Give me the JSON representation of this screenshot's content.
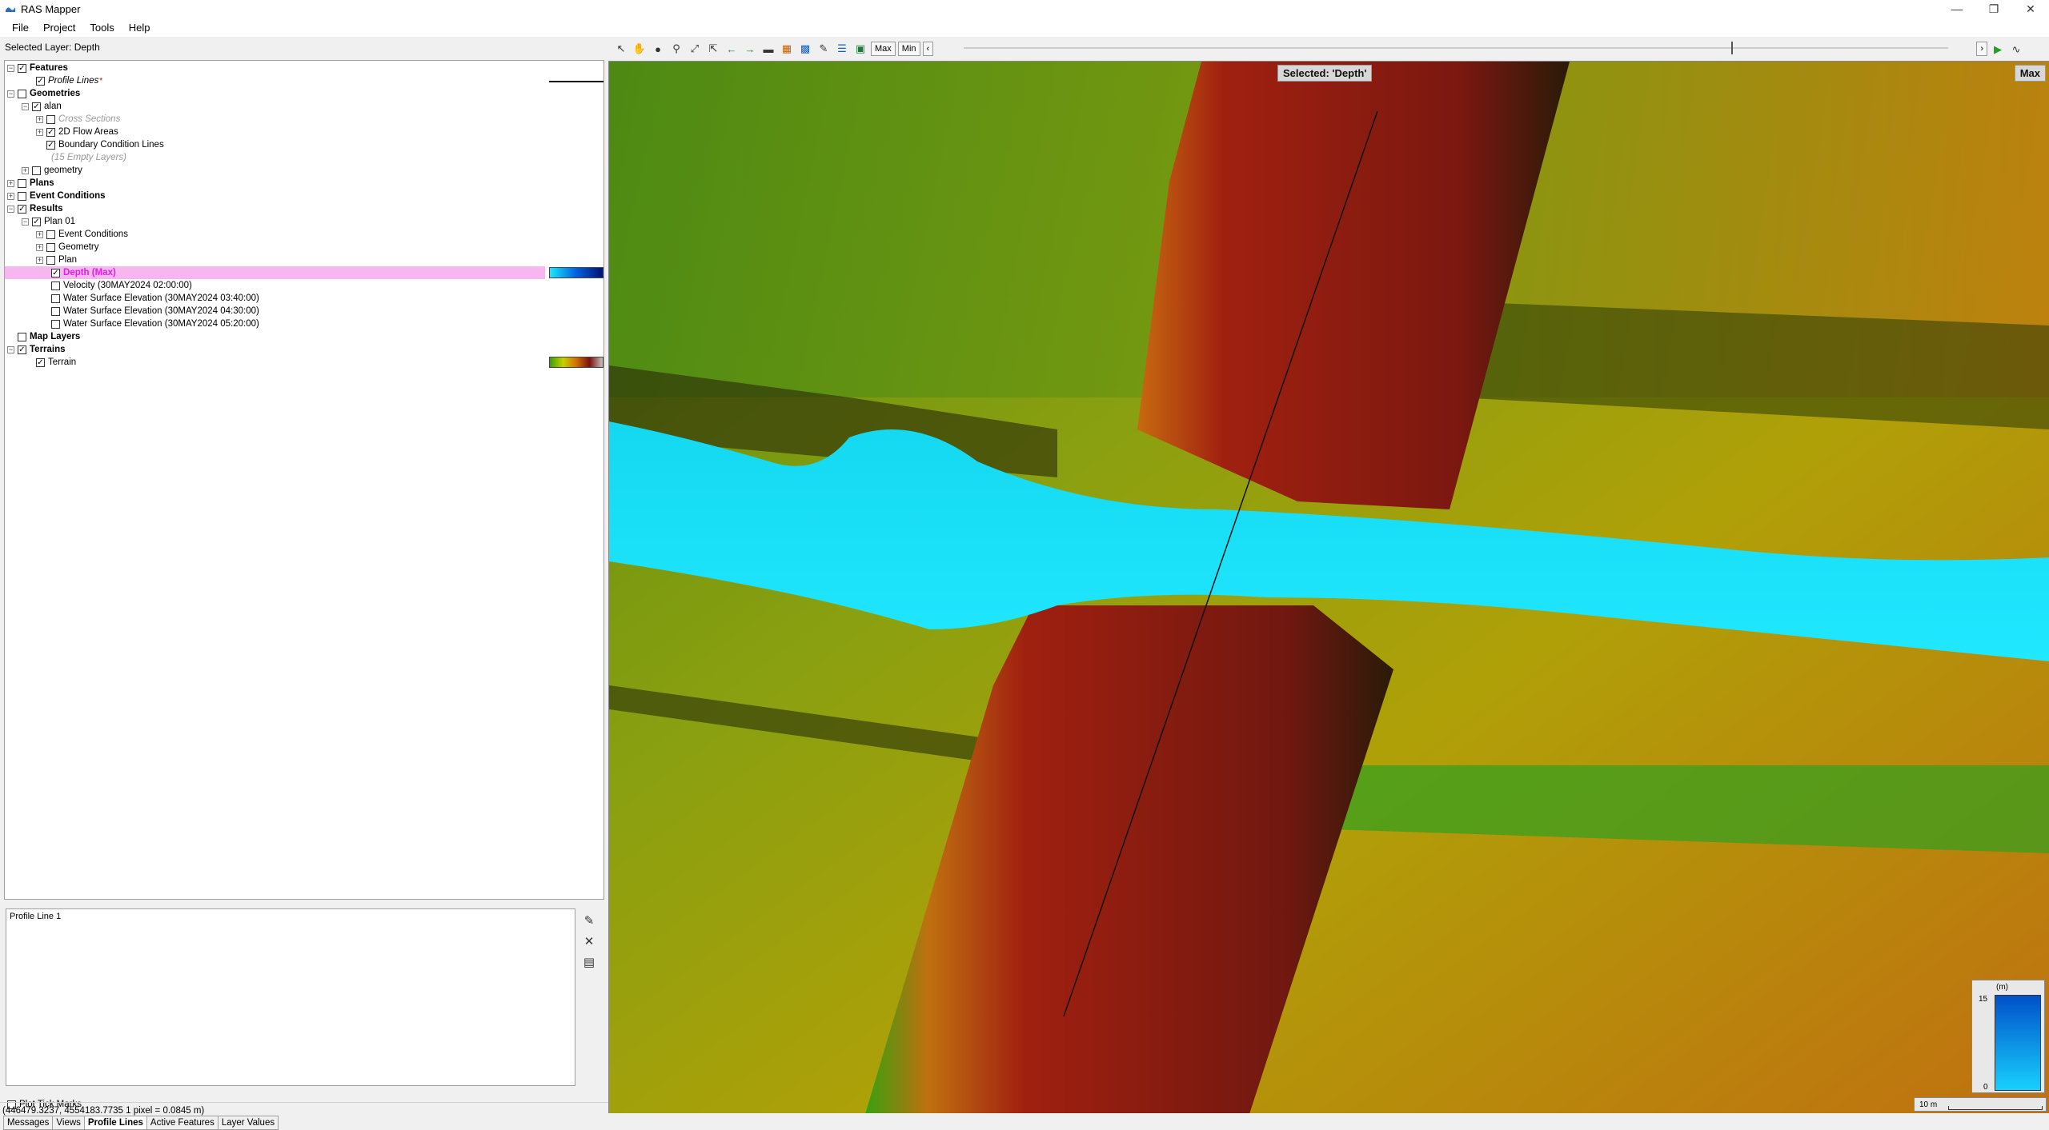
{
  "window": {
    "title": "RAS Mapper"
  },
  "menu": [
    "File",
    "Project",
    "Tools",
    "Help"
  ],
  "selected_layer": "Selected Layer: Depth",
  "tree": {
    "features": "Features",
    "profile_lines": "Profile Lines",
    "profile_lines_mark": "*",
    "geometries": "Geometries",
    "alan": "alan",
    "cross_sections": "Cross Sections",
    "flow_areas": "2D Flow Areas",
    "bc_lines": "Boundary Condition Lines",
    "empty_layers": "(15 Empty Layers)",
    "geometry": "geometry",
    "plans": "Plans",
    "event_conditions": "Event Conditions",
    "results": "Results",
    "plan01": "Plan 01",
    "r_event_conditions": "Event Conditions",
    "r_geometry": "Geometry",
    "r_plan": "Plan",
    "depth": "Depth (Max)",
    "velocity": "Velocity (30MAY2024 02:00:00)",
    "wse1": "Water Surface Elevation (30MAY2024 03:40:00)",
    "wse2": "Water Surface Elevation (30MAY2024 04:30:00)",
    "wse3": "Water Surface Elevation (30MAY2024 05:20:00)",
    "map_layers": "Map Layers",
    "terrains": "Terrains",
    "terrain": "Terrain"
  },
  "profile_panel": {
    "item": "Profile Line 1",
    "plot_ticks": "Plot Tick Marks"
  },
  "tabs": [
    "Messages",
    "Views",
    "Profile Lines",
    "Active Features",
    "Layer Values"
  ],
  "active_tab": "Profile Lines",
  "status": "(446479.3237, 4554183.7735  1 pixel = 0.0845 m)",
  "toolbar": {
    "max": "Max",
    "min": "Min"
  },
  "map": {
    "selected_badge": "Selected: 'Depth'",
    "max_badge": "Max",
    "legend_unit": "(m)",
    "legend_max": "15",
    "legend_min": "0",
    "scale": "10 m"
  },
  "colors": {
    "water": "#19e8ff",
    "highlight": "#f8b6f0",
    "depth_label": "#e020e0"
  }
}
